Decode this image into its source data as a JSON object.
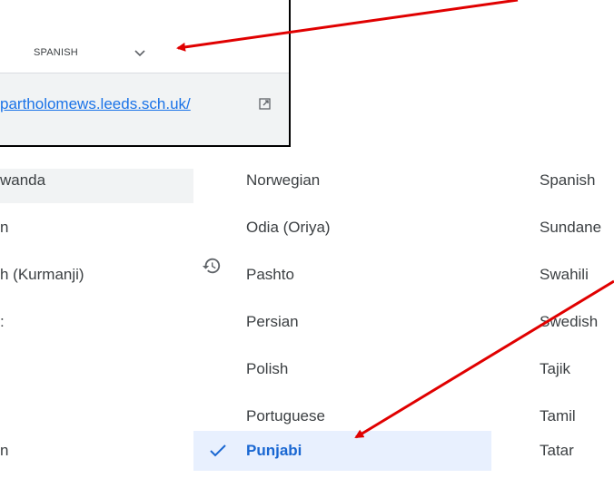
{
  "inset": {
    "dropdown_label": "SPANISH",
    "link_text": "partholomews.leeds.sch.uk/"
  },
  "columns": {
    "left": [
      "wanda",
      "n",
      "h (Kurmanji)",
      ":",
      "",
      "",
      "n"
    ],
    "middle": [
      "Norwegian",
      "Odia (Oriya)",
      "Pashto",
      "Persian",
      "Polish",
      "Portuguese",
      "Punjabi"
    ],
    "right": [
      "Spanish",
      "Sundane",
      "Swahili",
      "Swedish",
      "Tajik",
      "Tamil",
      "Tatar"
    ]
  },
  "selected_language": "Punjabi",
  "recent_language": "Pashto",
  "icons": {
    "chevron": "chevron-down-icon",
    "external": "external-link-icon",
    "check": "check-icon",
    "history": "history-icon"
  },
  "colors": {
    "link": "#1a73e8",
    "selected_bg": "#e8f0fe",
    "selected_text": "#1967d2",
    "arrow": "#e00000"
  }
}
